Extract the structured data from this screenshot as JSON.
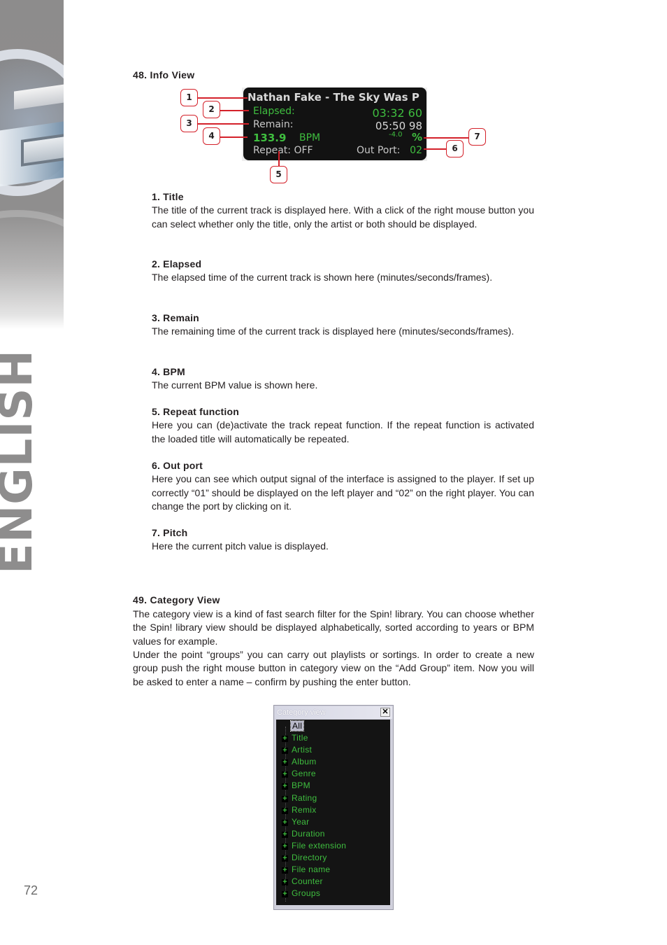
{
  "sidebar": {
    "language_label": "ENGLISH",
    "page_number": "72"
  },
  "section48": {
    "title": "48. Info View",
    "info_panel": {
      "track_title": "Nathan Fake - The Sky Was P",
      "elapsed_label": "Elapsed:",
      "elapsed_value": "03:32 60",
      "remain_label": "Remain:",
      "remain_value": "05:50 98",
      "bpm_value": "133.9",
      "bpm_label": "BPM",
      "pitch_value": "-4.0",
      "pitch_unit": "%",
      "repeat_text": "Repeat: OFF",
      "out_port_label": "Out Port:",
      "out_port_value": "02",
      "colors": {
        "green": "#3fbe3f",
        "panel_bg": "#121212",
        "callout_red": "#d4212a"
      }
    },
    "callouts": [
      "1",
      "2",
      "3",
      "4",
      "5",
      "6",
      "7"
    ],
    "items": [
      {
        "heading": "1. Title",
        "text": "The title of the current track is displayed here. With a click of the right mouse button you can select whether only the title, only the artist or both should be displayed."
      },
      {
        "heading": "2. Elapsed",
        "text": "The elapsed time of the current track is shown here (minutes/seconds/frames)."
      },
      {
        "heading": "3. Remain",
        "text": "The remaining time of the current track is displayed here (minutes/seconds/frames)."
      },
      {
        "heading": "4. BPM",
        "text": "The current BPM value is shown here."
      },
      {
        "heading": "5. Repeat function",
        "text": "Here you can (de)activate the track repeat function. If the repeat function is activated the loaded title will automatically be repeated."
      },
      {
        "heading": "6. Out port",
        "text": "Here you can see which output signal of the interface is assigned to the player. If set up correctly “01” should be displayed on the left player and “02” on the right player. You can change the port by clicking on it."
      },
      {
        "heading": "7. Pitch",
        "text": "Here the current pitch value is displayed."
      }
    ]
  },
  "section49": {
    "title": "49. Category View",
    "paragraph1": "The category view is a kind of fast search filter for the Spin! library. You can choose whether the Spin! library view should be displayed alphabetically, sorted according to years or BPM values for example.",
    "paragraph2": "Under the point “groups” you can carry out playlists or sortings. In order to create a new group push the right mouse button in category view on the “Add Group” item. Now you will be asked to enter a name – confirm by pushing the enter button.",
    "window": {
      "title": "Category view",
      "close_glyph": "✕",
      "expander_glyph": "+",
      "root_item": "All",
      "items": [
        "Title",
        "Artist",
        "Album",
        "Genre",
        "BPM",
        "Rating",
        "Remix",
        "Year",
        "Duration",
        "File extension",
        "Directory",
        "File name",
        "Counter",
        "Groups"
      ]
    }
  }
}
